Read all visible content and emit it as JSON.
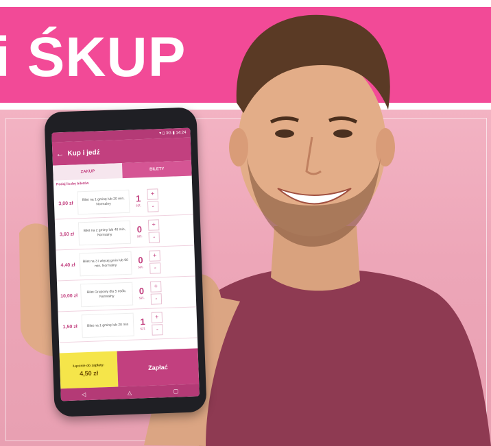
{
  "banner": {
    "title": "i ŚKUP",
    "color": "#f24a97"
  },
  "app": {
    "status_text": "▾ ▯ 3G ▮ 14:24",
    "title": "Kup i jedź",
    "back_icon": "arrow-left-icon",
    "tabs": [
      {
        "label": "ZAKUP",
        "active": true
      },
      {
        "label": "BILETY",
        "active": false
      }
    ],
    "section_label": "Podaj liczbę biletów",
    "tickets": [
      {
        "price": "3,00 zł",
        "description": "Bilet na 1 gminę lub 20 min, Normalny",
        "quantity": "1",
        "unit": "szt."
      },
      {
        "price": "3,60 zł",
        "description": "Bilet na 2 gminy lub 40 min, Normalny",
        "quantity": "0",
        "unit": "szt."
      },
      {
        "price": "4,40 zł",
        "description": "Bilet na 3 i więcej gmin lub 90 min, Normalny",
        "quantity": "0",
        "unit": "szt."
      },
      {
        "price": "10,00 zł",
        "description": "Bilet Grupowy dla 5 osób, Normalny",
        "quantity": "0",
        "unit": "szt."
      },
      {
        "price": "1,50 zł",
        "description": "Bilet na 1 gminę lub 20 min",
        "quantity": "1",
        "unit": "szt."
      }
    ],
    "plus_label": "+",
    "minus_label": "-",
    "total_label": "Łącznie do zapłaty:",
    "total_amount": "4,50 zł",
    "pay_label": "Zapłać",
    "nav": {
      "back": "◁",
      "home": "△",
      "recent": "▢"
    },
    "accent": "#c2407f",
    "total_bg": "#f5e54a"
  }
}
